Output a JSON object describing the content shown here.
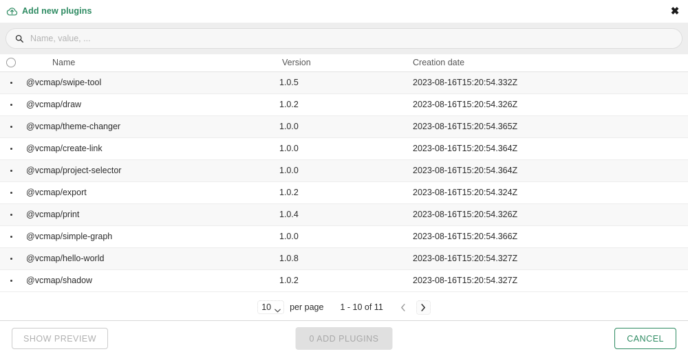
{
  "window": {
    "title": "Add new plugins",
    "title_icon": "cloud-upload-icon",
    "close_label": "✖",
    "accent_color": "#2e8b62"
  },
  "search": {
    "icon": "search-icon",
    "placeholder": "Name, value, ...",
    "value": ""
  },
  "table": {
    "select_all_icon": "radio-unchecked-icon",
    "columns": [
      {
        "key": "name",
        "label": "Name"
      },
      {
        "key": "version",
        "label": "Version"
      },
      {
        "key": "creation_date",
        "label": "Creation date"
      }
    ],
    "rows": [
      {
        "name": "@vcmap/swipe-tool",
        "version": "1.0.5",
        "creation_date": "2023-08-16T15:20:54.332Z"
      },
      {
        "name": "@vcmap/draw",
        "version": "1.0.2",
        "creation_date": "2023-08-16T15:20:54.326Z"
      },
      {
        "name": "@vcmap/theme-changer",
        "version": "1.0.0",
        "creation_date": "2023-08-16T15:20:54.365Z"
      },
      {
        "name": "@vcmap/create-link",
        "version": "1.0.0",
        "creation_date": "2023-08-16T15:20:54.364Z"
      },
      {
        "name": "@vcmap/project-selector",
        "version": "1.0.0",
        "creation_date": "2023-08-16T15:20:54.364Z"
      },
      {
        "name": "@vcmap/export",
        "version": "1.0.2",
        "creation_date": "2023-08-16T15:20:54.324Z"
      },
      {
        "name": "@vcmap/print",
        "version": "1.0.4",
        "creation_date": "2023-08-16T15:20:54.326Z"
      },
      {
        "name": "@vcmap/simple-graph",
        "version": "1.0.0",
        "creation_date": "2023-08-16T15:20:54.366Z"
      },
      {
        "name": "@vcmap/hello-world",
        "version": "1.0.8",
        "creation_date": "2023-08-16T15:20:54.327Z"
      },
      {
        "name": "@vcmap/shadow",
        "version": "1.0.2",
        "creation_date": "2023-08-16T15:20:54.327Z"
      }
    ]
  },
  "pagination": {
    "per_page_value": "10",
    "per_page_label": "per page",
    "range_label": "1 - 10 of 11",
    "prev_icon": "chevron-left-icon",
    "next_icon": "chevron-right-icon",
    "dropdown_icon": "chevron-down-icon"
  },
  "footer": {
    "show_preview_label": "SHOW PREVIEW",
    "add_plugins_label": "0 ADD PLUGINS",
    "cancel_label": "CANCEL"
  }
}
